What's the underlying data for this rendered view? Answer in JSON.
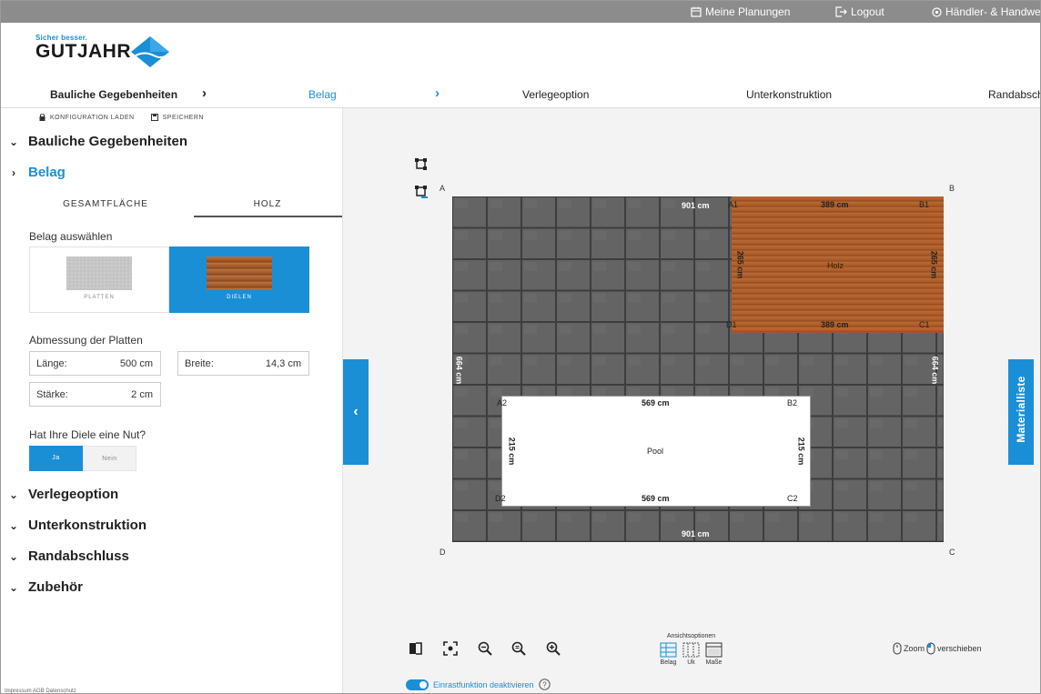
{
  "topbar": {
    "my_plans": "Meine Planungen",
    "logout": "Logout",
    "dealer": "Händler- & Handwerk"
  },
  "logo": {
    "tagline": "Sicher besser.",
    "wordmark": "GUTJAHR"
  },
  "steps": [
    {
      "label": "Bauliche Gegebenheiten",
      "state": "done"
    },
    {
      "label": "Belag",
      "state": "active"
    },
    {
      "label": "Verlegeoption",
      "state": "todo"
    },
    {
      "label": "Unterkonstruktion",
      "state": "todo"
    },
    {
      "label": "Randabsch",
      "state": "todo"
    }
  ],
  "config_actions": {
    "load": "KONFIGURATION LADEN",
    "save": "SPEICHERN"
  },
  "sections": {
    "bauliche": "Bauliche Gegebenheiten",
    "belag": "Belag",
    "verlegeoption": "Verlegeoption",
    "unterkonstruktion": "Unterkonstruktion",
    "randabschluss": "Randabschluss",
    "zubehoer": "Zubehör"
  },
  "belag_tabs": [
    "GESAMTFLÄCHE",
    "HOLZ"
  ],
  "belag_select_label": "Belag auswählen",
  "belag_options": [
    {
      "label": "PLATTEN",
      "selected": false
    },
    {
      "label": "DIELEN",
      "selected": true
    }
  ],
  "dimensions": {
    "title": "Abmessung der Platten",
    "length_label": "Länge:",
    "length_value": "500 cm",
    "width_label": "Breite:",
    "width_value": "14,3 cm",
    "thickness_label": "Stärke:",
    "thickness_value": "2 cm"
  },
  "groove": {
    "question": "Hat Ihre Diele eine Nut?",
    "yes": "Ja",
    "no": "Nein",
    "selected": "Ja"
  },
  "footer_links": "Impressum  AGB  Datenschutz",
  "plan": {
    "corners": {
      "A": "A",
      "B": "B",
      "C": "C",
      "D": "D"
    },
    "top_width": "901 cm",
    "bottom_width": "901 cm",
    "left_height": "664 cm",
    "right_height": "664 cm",
    "wood": {
      "label": "Holz",
      "top": "389 cm",
      "bottom": "389 cm",
      "left": "265 cm",
      "right": "265 cm",
      "corners": {
        "a": "A1",
        "b": "B1",
        "c": "C1",
        "d": "D1"
      }
    },
    "pool": {
      "label": "Pool",
      "top": "569 cm",
      "bottom": "569 cm",
      "left": "215 cm",
      "right": "215 cm",
      "corners": {
        "a": "A2",
        "b": "B2",
        "c": "C2",
        "d": "D2"
      }
    }
  },
  "materialliste": "Materialliste",
  "view_options": {
    "title": "Ansichtsoptionen",
    "items": [
      "Belag",
      "Uk",
      "Maße"
    ]
  },
  "hint": {
    "zoom": "Zoom",
    "move": "verschieben"
  },
  "snap": "Einrastfunktion deaktivieren",
  "colors": {
    "accent": "#1a8fd6",
    "topbar": "#8c8c8c",
    "tile": "#5f5f5f",
    "wood": "#a8592a"
  }
}
